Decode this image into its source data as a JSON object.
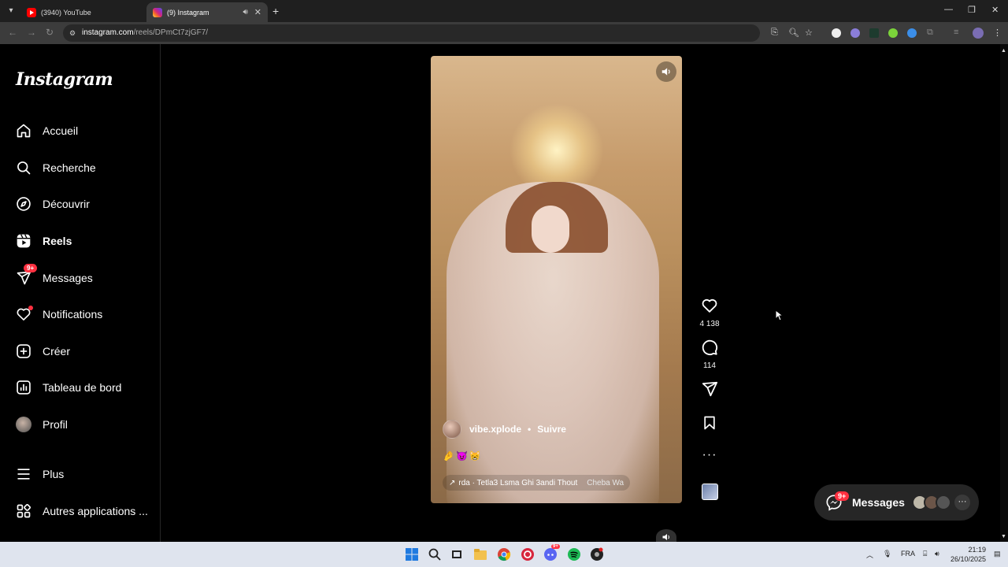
{
  "browser": {
    "tabs": [
      {
        "title": "(3940) YouTube",
        "active": false,
        "favicon": "youtube-icon"
      },
      {
        "title": "(9) Instagram",
        "active": true,
        "favicon": "instagram-icon"
      }
    ],
    "url_host": "instagram.com",
    "url_path": "/reels/DPmCt7zjGF7/"
  },
  "sidebar": {
    "logo": "Instagram",
    "items": [
      {
        "label": "Accueil",
        "icon": "home-icon"
      },
      {
        "label": "Recherche",
        "icon": "search-icon"
      },
      {
        "label": "Découvrir",
        "icon": "compass-icon"
      },
      {
        "label": "Reels",
        "icon": "reels-icon",
        "active": true
      },
      {
        "label": "Messages",
        "icon": "messenger-icon",
        "badge": "9+"
      },
      {
        "label": "Notifications",
        "icon": "heart-icon",
        "dot": true
      },
      {
        "label": "Créer",
        "icon": "plus-square-icon"
      },
      {
        "label": "Tableau de bord",
        "icon": "dashboard-icon"
      },
      {
        "label": "Profil",
        "icon": "avatar"
      },
      {
        "label": "Plus",
        "icon": "menu-icon"
      },
      {
        "label": "Autres applications ...",
        "icon": "apps-icon"
      }
    ]
  },
  "reel": {
    "author": "vibe.xplode",
    "separator": "•",
    "follow_label": "Suivre",
    "caption": "🤌😈😸",
    "music_arrow": "↗",
    "music_title": "rda · Tetla3 Lsma Ghi 3andi Thout",
    "music_artist": "Cheba Wa",
    "likes": "4 138",
    "comments": "114"
  },
  "messages_pill": {
    "label": "Messages",
    "badge": "9+",
    "more": "···"
  },
  "taskbar": {
    "lang": "FRA",
    "time": "21:19",
    "date": "26/10/2025",
    "discord_badge": "9+"
  },
  "colors": {
    "badge": "#ff3040",
    "pill_bg": "#262626",
    "taskbar_bg": "#dfe4ee"
  }
}
